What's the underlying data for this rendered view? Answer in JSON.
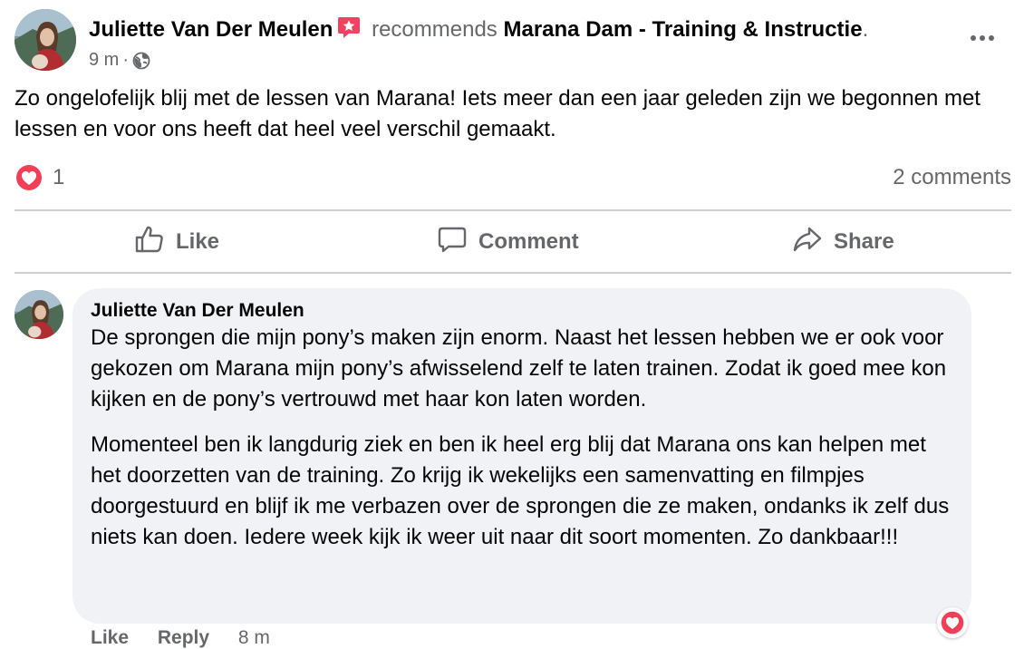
{
  "post": {
    "author": "Juliette Van Der Meulen",
    "recommends_label": "recommends",
    "page_name": "Marana Dam - Training & Instructie",
    "page_suffix": ".",
    "time": "9 m",
    "separator": "·",
    "privacy_icon": "globe-icon",
    "body": "Zo ongelofelijk blij met de lessen van Marana! Iets meer dan een jaar geleden zijn we begonnen met lessen en voor ons heeft dat heel veel verschil gemaakt."
  },
  "stats": {
    "reaction_icon": "heart-icon",
    "reaction_count": "1",
    "comments": "2 comments"
  },
  "actions": {
    "like": "Like",
    "comment": "Comment",
    "share": "Share"
  },
  "comment": {
    "author": "Juliette Van Der Meulen",
    "paragraph1": "De sprongen die mijn pony’s maken zijn enorm. Naast het lessen hebben we er ook voor gekozen om Marana mijn pony’s afwisselend zelf te laten trainen. Zodat ik goed mee kon kijken en de pony’s vertrouwd met haar kon laten worden.",
    "paragraph2": "Momenteel ben ik langdurig ziek en ben ik heel erg blij dat Marana ons kan helpen met het doorzetten van de training. Zo krijg ik wekelijks een samenvatting en filmpjes doorgestuurd en blijf ik me verbazen over de sprongen die ze maken, ondanks ik zelf dus niets kan doen. Iedere week kijk ik weer uit naar dit soort momenten. Zo dankbaar!!!",
    "like": "Like",
    "reply": "Reply",
    "time": "8 m"
  },
  "colors": {
    "recommend_badge": "#f3425f",
    "heart": "#f33e58",
    "secondary_text": "#65676b",
    "bubble": "#f0f2f5"
  }
}
